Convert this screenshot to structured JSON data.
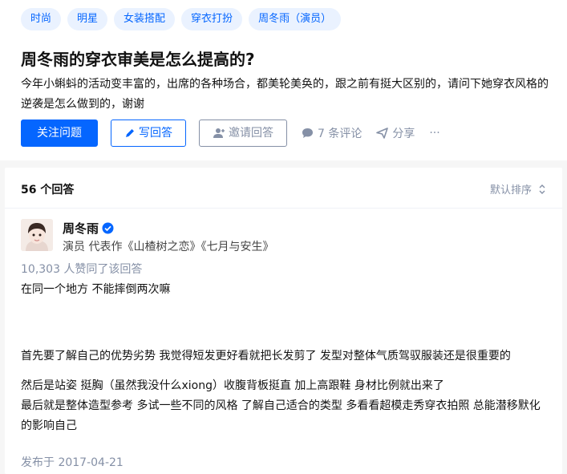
{
  "topics": [
    "时尚",
    "明星",
    "女装搭配",
    "穿衣打扮",
    "周冬雨（演员）"
  ],
  "question": {
    "title": "周冬雨的穿衣审美是怎么提高的?",
    "description": "今年小蝌蚪的活动变丰富的，出席的各种场合，都美轮美奂的，跟之前有挺大区别的，请问下她穿衣风格的逆袭是怎么做到的，谢谢"
  },
  "actions": {
    "follow_label": "关注问题",
    "write_label": "写回答",
    "invite_label": "邀请回答",
    "comments_label": "7 条评论",
    "share_label": "分享",
    "more_label": "···"
  },
  "answers": {
    "count_label": "56 个回答",
    "sort_label": "默认排序"
  },
  "answer": {
    "author_name": "周冬雨",
    "author_bio": "演员 代表作《山楂树之恋》《七月与安生》",
    "votes": "10,303 人赞同了该回答",
    "paragraphs": [
      "在同一个地方 不能摔倒两次嘛",
      "首先要了解自己的优势劣势 我觉得短发更好看就把长发剪了 发型对整体气质驾驭服装还是很重要的",
      "然后是站姿 挺胸（虽然我没什么xiong）收腹背板挺直 加上高跟鞋 身材比例就出来了",
      "最后就是整体造型参考 多试一些不同的风格 了解自己适合的类型 多看看超模走秀穿衣拍照 总能潜移默化的影响自己"
    ],
    "published": "发布于 2017-04-21"
  },
  "colors": {
    "brand": "#0566ff",
    "muted": "#8590a6",
    "tag_bg": "#eaf2ff"
  },
  "icons": [
    "pen-icon",
    "add-user-icon",
    "comment-icon",
    "share-icon",
    "sort-icon",
    "verified-icon"
  ]
}
